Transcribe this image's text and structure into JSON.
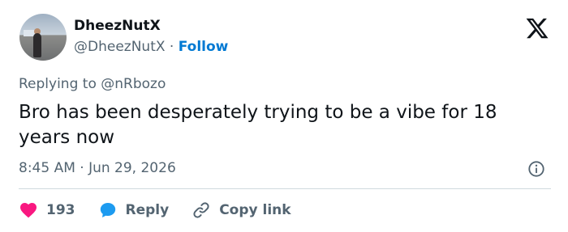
{
  "author": {
    "display_name": "DheezNutX",
    "handle": "@DheezNutX",
    "separator": " · ",
    "follow_label": "Follow"
  },
  "reply_context": {
    "prefix": "Replying to ",
    "mention": "@nRbozo"
  },
  "tweet": {
    "text": "Bro has been desperately trying to be a vibe for 18 years now",
    "timestamp": "8:45 AM · Jun 29, 2026"
  },
  "actions": {
    "like_count": "193",
    "reply_label": "Reply",
    "copy_label": "Copy link"
  },
  "colors": {
    "accent": "#0079d3",
    "like": "#f91880",
    "reply": "#1d9bf0",
    "muted": "#536471"
  },
  "icons": [
    "x-logo-icon",
    "info-icon",
    "heart-icon",
    "reply-bubble-icon",
    "link-icon"
  ]
}
